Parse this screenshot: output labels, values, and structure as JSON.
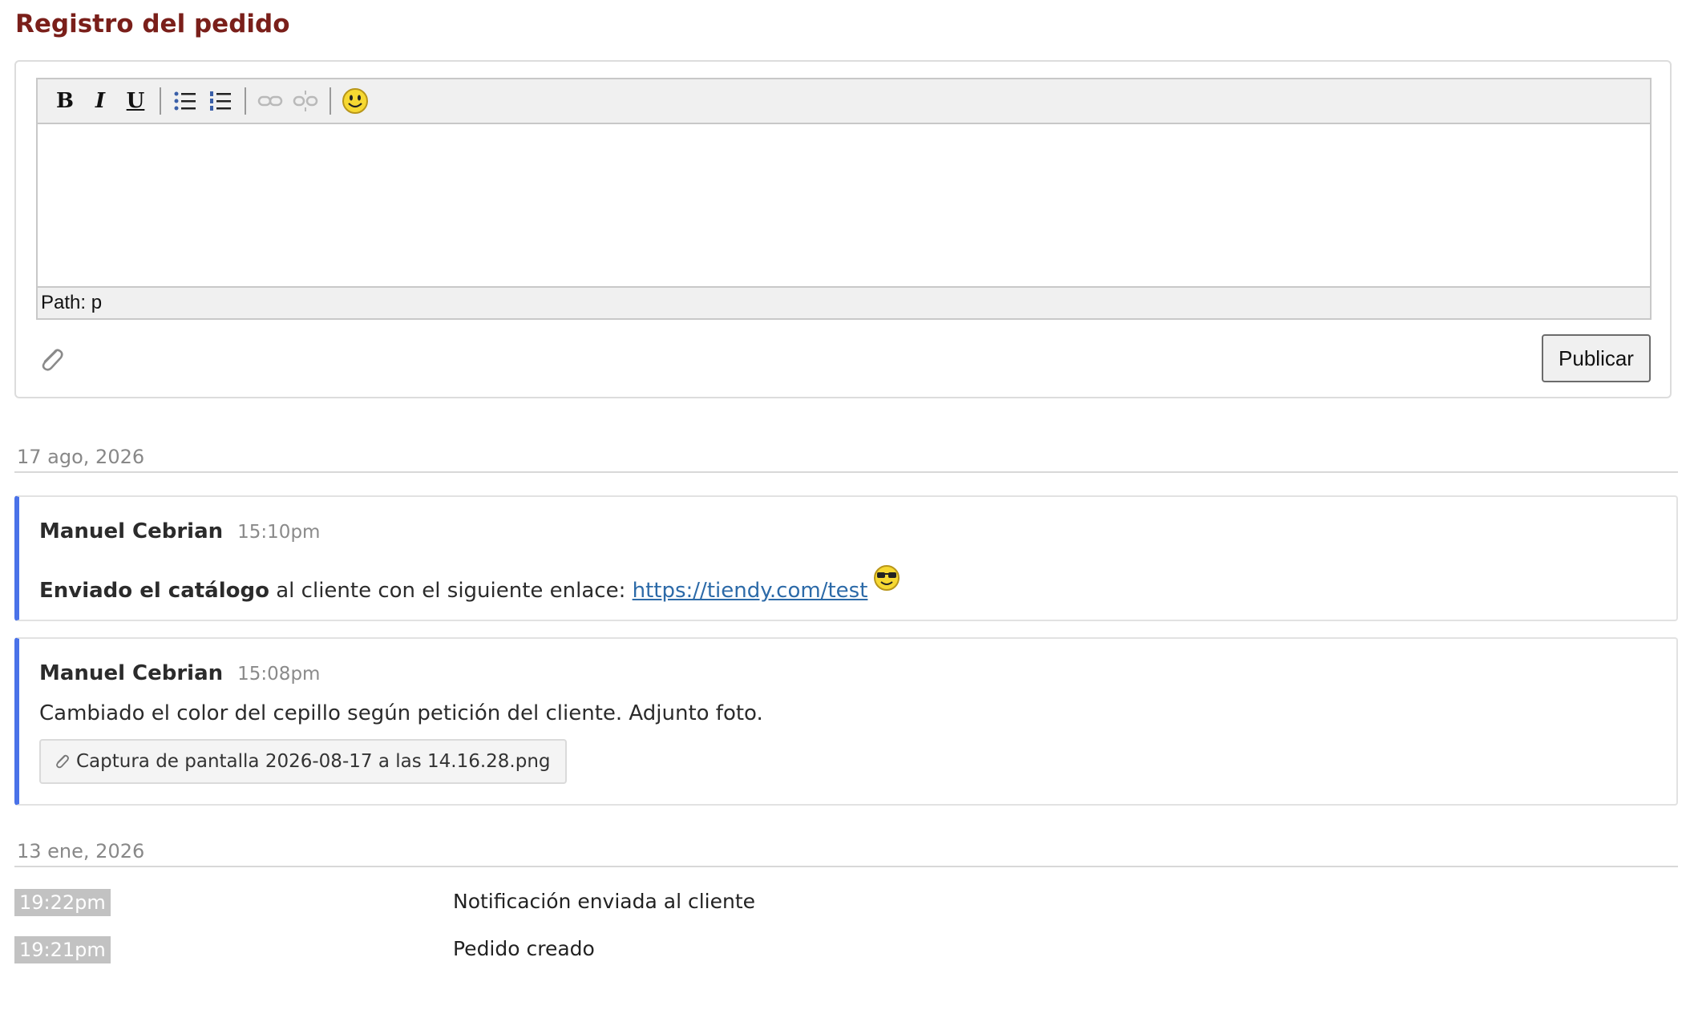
{
  "header": {
    "title": "Registro del pedido"
  },
  "editor": {
    "toolbar": {
      "bold": "B",
      "italic": "I",
      "underline": "U"
    },
    "path_label": "Path: p",
    "publish_label": "Publicar"
  },
  "log": {
    "groups": [
      {
        "date": "17 ago, 2026",
        "notes": [
          {
            "author": "Manuel Cebrian",
            "time": "15:10pm",
            "body_bold": "Enviado el catálogo",
            "body_text": " al cliente con el siguiente enlace: ",
            "link": "https://tiendy.com/test",
            "emoji": "sunglasses-emoji"
          },
          {
            "author": "Manuel Cebrian",
            "time": "15:08pm",
            "body_text": "Cambiado el color del cepillo según petición del cliente. Adjunto foto.",
            "attachment": "Captura de pantalla 2026-08-17 a las 14.16.28.png"
          }
        ]
      },
      {
        "date": "13 ene, 2026",
        "events": [
          {
            "time": "19:22pm",
            "text": "Notificación enviada al cliente"
          },
          {
            "time": "19:21pm",
            "text": "Pedido creado"
          }
        ]
      }
    ]
  },
  "colors": {
    "title": "#7a1f1a",
    "note_accent": "#4a72e8",
    "link": "#2c6aa8",
    "time_badge_bg": "#c2c2c2"
  }
}
